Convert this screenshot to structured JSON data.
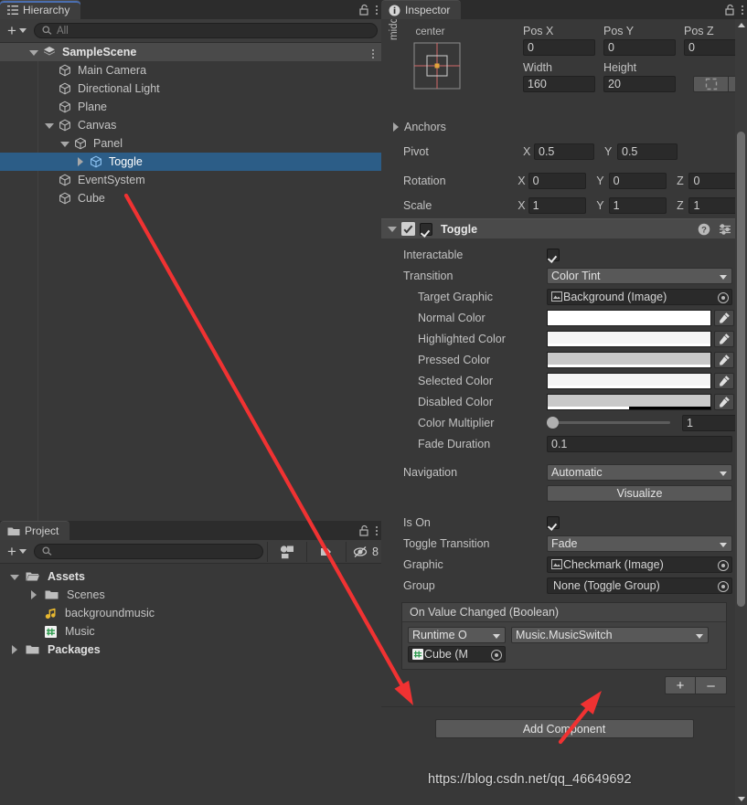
{
  "hierarchy": {
    "tab_label": "Hierarchy",
    "lock_icon": "lock-open-icon",
    "menu_icon": "kebab-menu-icon",
    "create_label": "+",
    "search": {
      "placeholder": "All",
      "value": "",
      "icon": "search-icon"
    },
    "tree": [
      {
        "label": "SampleScene",
        "depth": 0,
        "fold": "open",
        "icon": "scene-icon",
        "kind": "scene"
      },
      {
        "label": "Main Camera",
        "depth": 1,
        "fold": "none",
        "icon": "cube-icon",
        "kind": "gameobject"
      },
      {
        "label": "Directional Light",
        "depth": 1,
        "fold": "none",
        "icon": "cube-icon",
        "kind": "gameobject"
      },
      {
        "label": "Plane",
        "depth": 1,
        "fold": "none",
        "icon": "cube-icon",
        "kind": "gameobject"
      },
      {
        "label": "Canvas",
        "depth": 1,
        "fold": "open",
        "icon": "cube-icon",
        "kind": "gameobject"
      },
      {
        "label": "Panel",
        "depth": 2,
        "fold": "open",
        "icon": "cube-icon",
        "kind": "gameobject"
      },
      {
        "label": "Toggle",
        "depth": 3,
        "fold": "closed",
        "icon": "cube-icon",
        "kind": "selected"
      },
      {
        "label": "EventSystem",
        "depth": 1,
        "fold": "none",
        "icon": "cube-icon",
        "kind": "gameobject"
      },
      {
        "label": "Cube",
        "depth": 1,
        "fold": "none",
        "icon": "cube-icon",
        "kind": "gameobject"
      }
    ]
  },
  "project": {
    "tab_label": "Project",
    "tab_icon": "folder-icon",
    "lock_icon": "lock-open-icon",
    "menu_icon": "kebab-menu-icon",
    "create_label": "+",
    "search": {
      "placeholder": "",
      "value": "",
      "icon": "search-icon"
    },
    "toolbar_icons": [
      "asset-filter-icon",
      "label-filter-icon",
      "hidden-packages-icon"
    ],
    "hidden_count": "8",
    "tree": [
      {
        "label": "Assets",
        "depth": 0,
        "fold": "open",
        "icon": "folder-open-icon",
        "bold": true
      },
      {
        "label": "Scenes",
        "depth": 1,
        "fold": "closed",
        "icon": "folder-icon",
        "bold": false
      },
      {
        "label": "backgroundmusic",
        "depth": 1,
        "fold": "none",
        "icon": "audio-clip-icon",
        "bold": false
      },
      {
        "label": "Music",
        "depth": 1,
        "fold": "none",
        "icon": "csharp-script-icon",
        "bold": false
      },
      {
        "label": "Packages",
        "depth": 0,
        "fold": "closed",
        "icon": "folder-icon",
        "bold": true
      }
    ]
  },
  "inspector": {
    "tab_label": "Inspector",
    "tab_icon": "info-icon",
    "lock_icon": "lock-open-icon",
    "menu_icon": "kebab-menu-icon",
    "rect_transform": {
      "anchor_preset_h": "center",
      "anchor_preset_v": "middle",
      "position": {
        "labels": [
          "Pos X",
          "Pos Y",
          "Pos Z"
        ],
        "values": [
          "0",
          "0",
          "0"
        ]
      },
      "size": {
        "labels": [
          "Width",
          "Height"
        ],
        "values": [
          "160",
          "20"
        ]
      },
      "blueprint_button": "blueprint-mode-icon",
      "rawedit_button": "R",
      "anchors_label": "Anchors",
      "pivot": {
        "label": "Pivot",
        "x_label": "X",
        "x": "0.5",
        "y_label": "Y",
        "y": "0.5"
      },
      "rotation": {
        "label": "Rotation",
        "x_label": "X",
        "x": "0",
        "y_label": "Y",
        "y": "0",
        "z_label": "Z",
        "z": "0"
      },
      "scale": {
        "label": "Scale",
        "x_label": "X",
        "x": "1",
        "y_label": "Y",
        "y": "1",
        "z_label": "Z",
        "z": "1"
      }
    },
    "toggle_component": {
      "title": "Toggle",
      "enabled": true,
      "help_icon": "help-icon",
      "preset_icon": "preset-icon",
      "menu_icon": "kebab-menu-icon",
      "interactable": {
        "label": "Interactable",
        "checked": true
      },
      "transition": {
        "label": "Transition",
        "value": "Color Tint"
      },
      "target_graphic": {
        "label": "Target Graphic",
        "value": "Background (Image)",
        "icon": "image-component-icon"
      },
      "colors": [
        {
          "label": "Normal Color",
          "hex": "#ffffff",
          "alpha_hex": "#ffffff",
          "alpha_pct": 100
        },
        {
          "label": "Highlighted Color",
          "hex": "#f5f5f5",
          "alpha_hex": "#ffffff",
          "alpha_pct": 100
        },
        {
          "label": "Pressed Color",
          "hex": "#c8c8c8",
          "alpha_hex": "#ffffff",
          "alpha_pct": 100
        },
        {
          "label": "Selected Color",
          "hex": "#f5f5f5",
          "alpha_hex": "#ffffff",
          "alpha_pct": 100
        },
        {
          "label": "Disabled Color",
          "hex": "#c8c8c8",
          "alpha_hex": "#ffffff",
          "alpha_pct": 50
        }
      ],
      "color_multiplier": {
        "label": "Color Multiplier",
        "value": "1",
        "slider_pct": 0
      },
      "fade_duration": {
        "label": "Fade Duration",
        "value": "0.1"
      },
      "navigation": {
        "label": "Navigation",
        "value": "Automatic"
      },
      "visualize_button": "Visualize",
      "is_on": {
        "label": "Is On",
        "checked": true
      },
      "toggle_transition": {
        "label": "Toggle Transition",
        "value": "Fade"
      },
      "graphic": {
        "label": "Graphic",
        "value": "Checkmark (Image)",
        "icon": "image-component-icon"
      },
      "group": {
        "label": "Group",
        "value": "None (Toggle Group)",
        "icon": "none-icon"
      },
      "event": {
        "title": "On Value Changed (Boolean)",
        "entries": [
          {
            "mode": "Runtime O",
            "function": "Music.MusicSwitch",
            "target": "Cube (M",
            "target_icon": "csharp-script-icon"
          }
        ],
        "add_label": "+",
        "remove_label": "–"
      }
    },
    "add_component_button": "Add Component",
    "scroll_up_icon": "scroll-up-arrow-icon",
    "scroll_down_icon": "scroll-down-arrow-icon"
  },
  "annotations": {
    "watermark": "https://blog.csdn.net/qq_46649692",
    "arrow_color": "#f03232",
    "arrows": [
      {
        "name": "arrow-to-target-object",
        "from": [
          138,
          214
        ],
        "to": [
          452,
          772
        ]
      },
      {
        "name": "arrow-to-function-dropdown",
        "from": [
          613,
          812
        ],
        "to": [
          658,
          756
        ]
      }
    ]
  },
  "theme": {
    "window_bg": "#383838",
    "tabbar_bg": "#2c2c2c",
    "selection_blue": "#2c5d87",
    "accent_blue": "#4b6eaf",
    "field_bg": "#2a2a2a",
    "dropdown_bg": "#585858",
    "header_bg": "#4a4a4a"
  }
}
